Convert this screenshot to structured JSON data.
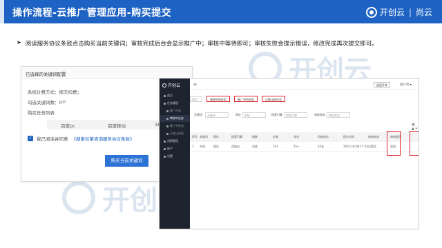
{
  "header": {
    "title": "操作流程-云推广管理应用-购买提交",
    "brand_name": "开创云",
    "brand_sep": "|",
    "brand_sub": "尚云"
  },
  "description": {
    "bullet": "➤",
    "text": "阅读服务协议条款点击购买当前关键词；审核完成后台会显示推广中；审核中等待即可；审核失败会提示错误，修改完成再次提交即可。"
  },
  "watermark": {
    "text": "开创云"
  },
  "dialog": {
    "title": "已选择的关键词配置",
    "billing": "系统计费方式：按天扣费；",
    "selected_count": "勾选关键词数：0个",
    "task_list_label": "购买任务列表",
    "table_cols": [
      "百度pc",
      "百度移动",
      "360"
    ],
    "agree_prefix": "我已阅读并同意",
    "agree_link": "《搜索引擎咨询服务协议条款》",
    "buy_button": "购买当前关键词"
  },
  "app": {
    "logo": "开创云",
    "sidebar_items": [
      {
        "label": "首页",
        "sub": false,
        "active": false
      },
      {
        "label": "任务管理",
        "sub": false,
        "active": false
      },
      {
        "label": "推广任务",
        "sub": true,
        "active": false
      },
      {
        "label": "审核中任务",
        "sub": true,
        "active": true
      },
      {
        "label": "推广中任务",
        "sub": true,
        "active": false
      },
      {
        "label": "已停止任务",
        "sub": true,
        "active": false
      },
      {
        "label": "消费管理",
        "sub": false,
        "active": false
      },
      {
        "label": "账户",
        "sub": false,
        "active": false
      },
      {
        "label": "设置",
        "sub": false,
        "active": false
      }
    ],
    "menu_icon": "≡",
    "top_button": "返回开关",
    "user": "用户 ID ▾",
    "tabs": [
      "首页",
      "审核中的任务",
      "推广中的任务",
      "已停止的任务"
    ],
    "filters": [
      {
        "label": "关键词",
        "placeholder": "关键词"
      },
      {
        "label": "网址",
        "placeholder": "网址"
      },
      {
        "label": "搜索引擎",
        "placeholder": "搜索引擎"
      },
      {
        "label": "审核状态",
        "placeholder": "审核状态"
      }
    ],
    "tools": "▦ ▲ ▾",
    "columns": [
      "序号",
      "关键词",
      "网址",
      "搜索引擎",
      "指数",
      "价格",
      "排名",
      "初始排名",
      "提交时间",
      "审核状态",
      "审核意见"
    ],
    "row": [
      "1",
      "开创",
      "网址",
      "百度pc",
      "百度",
      "10+",
      "15+",
      "16名",
      "2021-10-08 17:32",
      "已提交",
      "驳回"
    ]
  }
}
